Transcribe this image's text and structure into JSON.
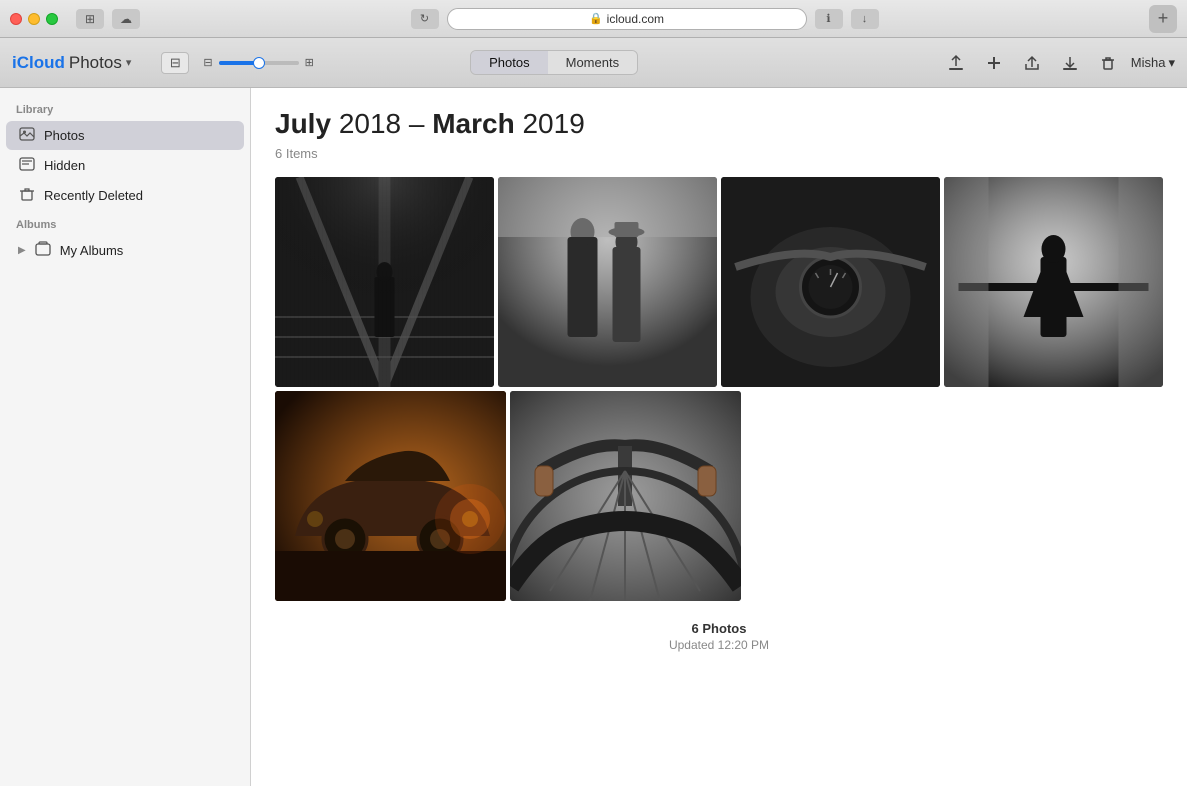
{
  "titlebar": {
    "url": "icloud.com",
    "new_tab_label": "+"
  },
  "toolbar": {
    "logo_icloud": "iCloud",
    "logo_photos": "Photos",
    "logo_caret": "▾",
    "photos_tab": "Photos",
    "moments_tab": "Moments",
    "user_name": "Misha",
    "user_caret": "▾"
  },
  "sidebar": {
    "library_label": "Library",
    "items": [
      {
        "id": "photos",
        "label": "Photos",
        "active": true
      },
      {
        "id": "hidden",
        "label": "Hidden",
        "active": false
      },
      {
        "id": "recently-deleted",
        "label": "Recently Deleted",
        "active": false
      }
    ],
    "albums_label": "Albums",
    "my_albums": "My Albums"
  },
  "content": {
    "date_range": "July 2018 – March 2019",
    "date_start_bold": "July",
    "date_start_light": "2018 –",
    "date_end_bold": "March",
    "date_end_light": "2019",
    "items_count": "6 Items",
    "photos_count": "6 Photos",
    "updated": "Updated 12:20 PM"
  },
  "photos": [
    {
      "id": "p1",
      "desc": "Man walking on bridge black and white"
    },
    {
      "id": "p2",
      "desc": "Couple standing black and white"
    },
    {
      "id": "p3",
      "desc": "Motorcycle dashboard black and white"
    },
    {
      "id": "p4",
      "desc": "Man with arms spread black and white"
    },
    {
      "id": "p5",
      "desc": "Vintage Porsche car warm tones"
    },
    {
      "id": "p6",
      "desc": "Bicycle handlebar black and white"
    }
  ]
}
